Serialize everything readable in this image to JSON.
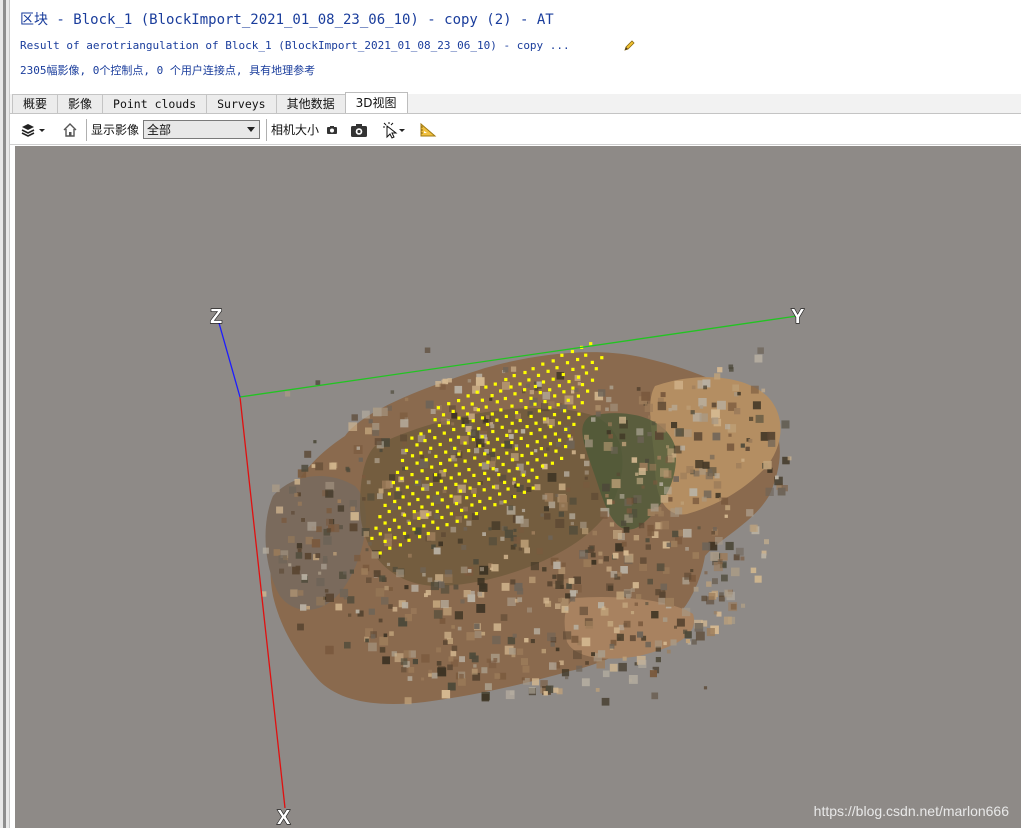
{
  "header": {
    "title": "区块 - Block_1 (BlockImport_2021_01_08_23_06_10) - copy (2) - AT",
    "subtitle": "Result of aerotriangulation of Block_1 (BlockImport_2021_01_08_23_06_10) - copy ...",
    "stats": "2305幅影像, 0个控制点, 0 个用户连接点, 具有地理参考"
  },
  "tabs": [
    {
      "label": "概要"
    },
    {
      "label": "影像"
    },
    {
      "label": "Point clouds"
    },
    {
      "label": "Surveys"
    },
    {
      "label": "其他数据"
    },
    {
      "label": "3D视图",
      "active": true
    }
  ],
  "toolbar": {
    "layers_icon": "layers-icon",
    "home_icon": "home-icon",
    "display_images_label": "显示影像",
    "display_images_value": "全部",
    "camera_size_label": "相机大小",
    "camera_small_icon": "camera-small-icon",
    "camera_large_icon": "camera-large-icon",
    "select_tool_icon": "select-cursor-icon",
    "measure_icon": "ruler-triangle-icon"
  },
  "viewport": {
    "background_color": "#8e8a87",
    "axis_labels": {
      "x": "X",
      "y": "Y",
      "z": "Z"
    },
    "axis_colors": {
      "x": "#e01010",
      "y": "#22c422",
      "z": "#1c1cff"
    },
    "camera_color": "#ffff00",
    "watermark": "https://blog.csdn.net/marlon666"
  }
}
